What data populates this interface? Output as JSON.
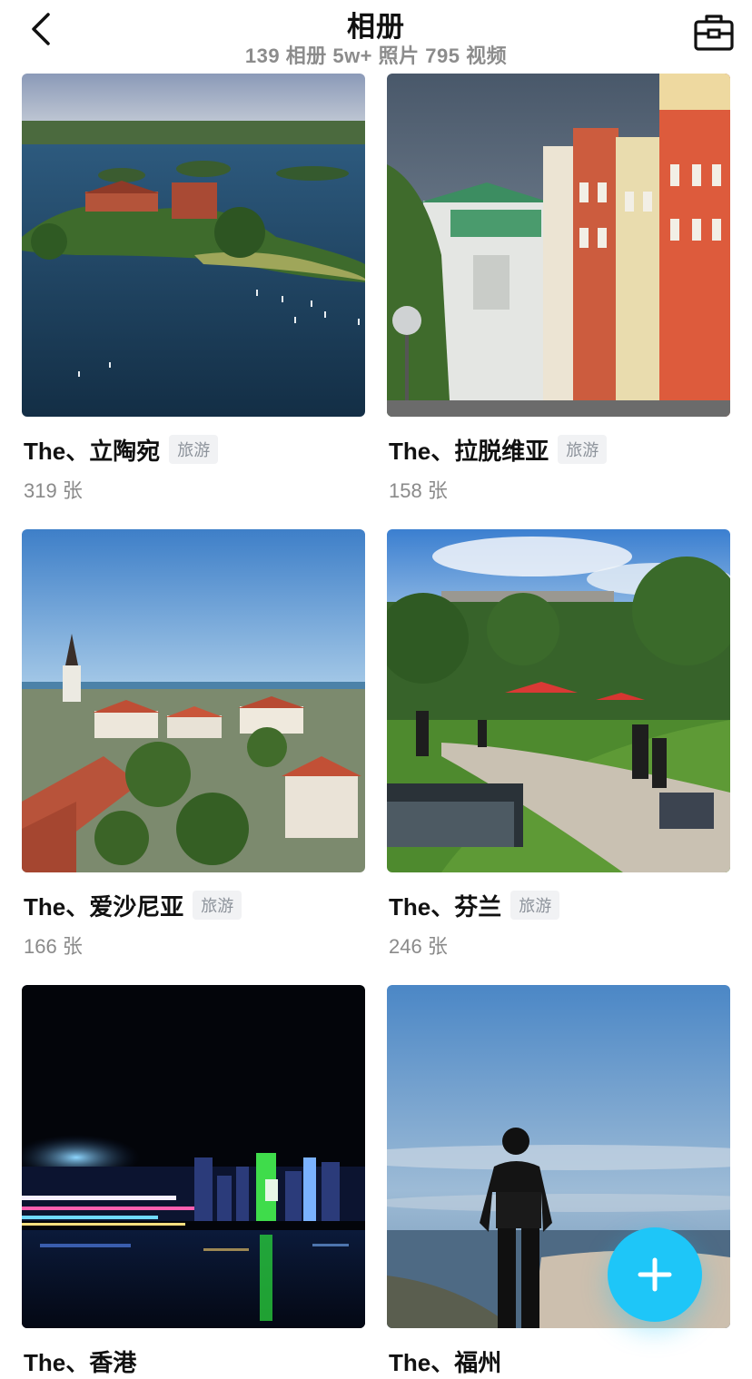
{
  "header": {
    "title": "相册",
    "subtitle": "139 相册 5w+ 照片 795 视频"
  },
  "albums": [
    {
      "name": "The、立陶宛",
      "tag": "旅游",
      "count": "319 张"
    },
    {
      "name": "The、拉脱维亚",
      "tag": "旅游",
      "count": "158 张"
    },
    {
      "name": "The、爱沙尼亚",
      "tag": "旅游",
      "count": "166 张"
    },
    {
      "name": "The、芬兰",
      "tag": "旅游",
      "count": "246 张"
    },
    {
      "name": "The、香港"
    },
    {
      "name": "The、福州"
    }
  ],
  "icons": {
    "back": "chevron-left-icon",
    "toolbox": "toolbox-icon",
    "fab": "plus-icon"
  },
  "colors": {
    "accent": "#1ec6f8",
    "tag_bg": "#f1f2f4",
    "tag_text": "#8d939b",
    "muted_text": "#8a8a8a"
  }
}
